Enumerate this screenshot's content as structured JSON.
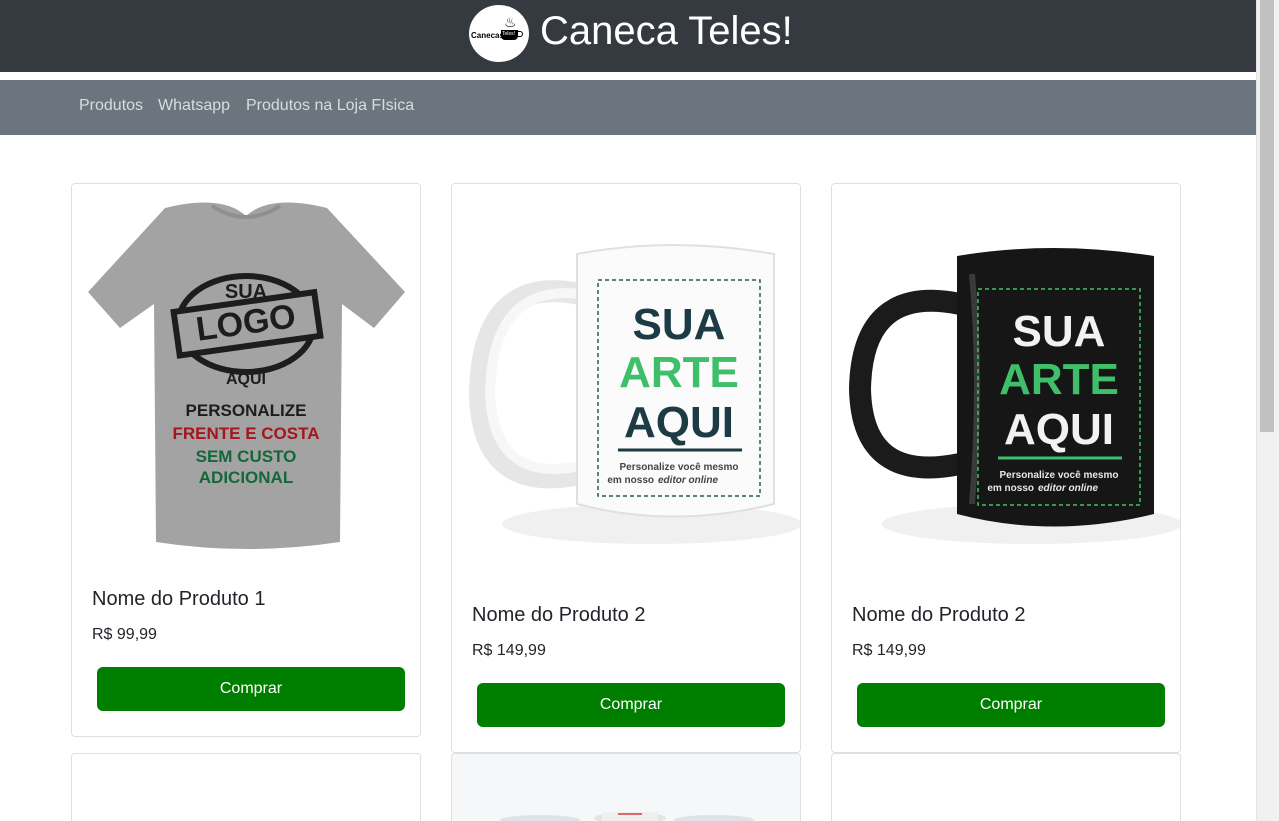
{
  "header": {
    "logo_text": "Canecas",
    "logo_cup_text": "Teles!",
    "title": "Caneca Teles!"
  },
  "nav": {
    "links": [
      "Produtos",
      "Whatsapp",
      "Produtos na Loja FIsica"
    ]
  },
  "products": [
    {
      "name": "Nome do Produto 1",
      "price": "R$ 99,99",
      "button": "Comprar",
      "image_text": [
        "SUA",
        "LOGO",
        "AQUI",
        "PERSONALIZE",
        "FRENTE E COSTA",
        "SEM CUSTO",
        "ADICIONAL"
      ]
    },
    {
      "name": "Nome do Produto 2",
      "price": "R$ 149,99",
      "button": "Comprar",
      "image_text": [
        "SUA",
        "ARTE",
        "AQUI",
        "Personalize você mesmo",
        "em nosso",
        "editor online"
      ]
    },
    {
      "name": "Nome do Produto 2",
      "price": "R$ 149,99",
      "button": "Comprar",
      "image_text": [
        "SUA",
        "ARTE",
        "AQUI",
        "Personalize você mesmo",
        "em nosso",
        "editor online"
      ]
    }
  ],
  "colors": {
    "header_bg": "#343a40",
    "nav_bg": "#6c757d",
    "button_bg": "#007e00",
    "accent_green": "#3fbf6a",
    "dark_teal": "#1d3b45"
  }
}
